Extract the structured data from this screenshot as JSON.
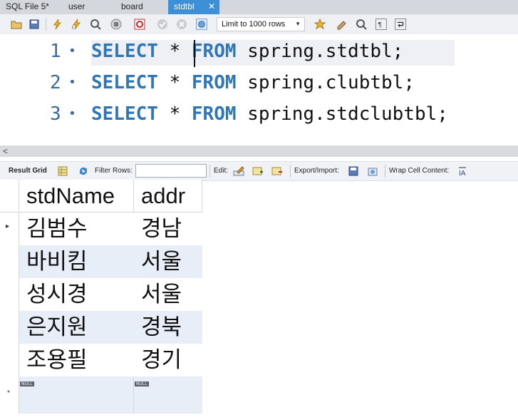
{
  "tabs": [
    {
      "label": "SQL File 5*",
      "active": false
    },
    {
      "label": "user",
      "active": false
    },
    {
      "label": "board",
      "active": false
    },
    {
      "label": "stdtbl",
      "active": true
    }
  ],
  "tab_close_glyph": "✕",
  "toolbar": {
    "limit_label": "Limit to 1000 rows",
    "icons": [
      "open-folder-icon",
      "save-icon",
      "execute-icon",
      "execute-current-icon",
      "explain-icon",
      "stop-icon",
      "toggle-autocommit-icon",
      "commit-icon",
      "rollback-icon",
      "beautify-icon",
      "limit-dropdown",
      "bookmark-icon",
      "format-icon",
      "find-icon",
      "invisible-chars-icon",
      "wrap-icon"
    ]
  },
  "editor": {
    "lines": [
      {
        "num": "1",
        "kw1": "SELECT",
        "star": " * ",
        "kw2": "FROM",
        "rest": " spring.stdtbl;"
      },
      {
        "num": "2",
        "kw1": "SELECT",
        "star": " * ",
        "kw2": "FROM",
        "rest": " spring.clubtbl;"
      },
      {
        "num": "3",
        "kw1": "SELECT",
        "star": " * ",
        "kw2": "FROM",
        "rest": " spring.stdclubtbl;"
      }
    ]
  },
  "scrollbar": {
    "left_arrow": "<"
  },
  "result_toolbar": {
    "result_grid": "Result Grid",
    "filter_rows": "Filter Rows:",
    "filter_value": "",
    "edit": "Edit:",
    "export_import": "Export/Import:",
    "wrap_cell": "Wrap Cell Content:"
  },
  "grid": {
    "columns": [
      "stdName",
      "addr"
    ],
    "rows": [
      [
        "김범수",
        "경남"
      ],
      [
        "바비킴",
        "서울"
      ],
      [
        "성시경",
        "서울"
      ],
      [
        "은지원",
        "경북"
      ],
      [
        "조용필",
        "경기"
      ]
    ],
    "current_row_marker": "▸",
    "new_row_marker": "*",
    "null_label": "NULL"
  },
  "colors": {
    "active_tab": "#3d8fd6",
    "keyword": "#2f76b6",
    "line_number": "#3c6aa0",
    "row_alt": "#e8eef8"
  }
}
